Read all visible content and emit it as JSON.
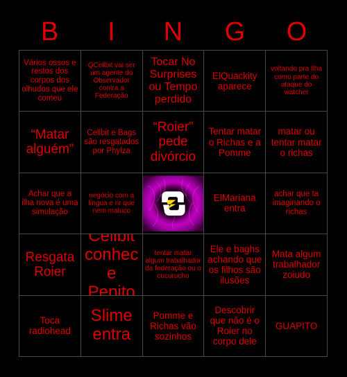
{
  "header": {
    "letters": [
      "B",
      "I",
      "N",
      "G",
      "O"
    ]
  },
  "colors": {
    "text_red": "#e00000",
    "background": "#000000",
    "grid_line": "#4a4a4a",
    "free_space_accent_purple": "#c000c0",
    "free_space_accent_yellow": "#ffe000"
  },
  "grid": {
    "columns": 5,
    "rows": 5,
    "cells": [
      {
        "text": "Vários ossos e restos dos corpos dos olhudos que ele comeu",
        "size": "sm"
      },
      {
        "text": "QCellbit vai ser um agente do Observador contra a Federação",
        "size": "xs"
      },
      {
        "text": "Tocar No Surprises ou Tempo perdido",
        "size": "lg"
      },
      {
        "text": "ElQuackity aparece",
        "size": "md"
      },
      {
        "text": "voltando pra Ilha como parte do ataque do watcher",
        "size": "xs"
      },
      {
        "text": "“Matar alguém”",
        "size": "xl"
      },
      {
        "text": "Cellbit e Bags são resgatados por Phylza",
        "size": "sm"
      },
      {
        "text": "“Roier” pede divórcio",
        "size": "xl"
      },
      {
        "text": "Tentar matar o Richas e a Pomme",
        "size": "md"
      },
      {
        "text": "matar ou tentar matar o richas",
        "size": "md"
      },
      {
        "text": "Achar que a ilha nova é uma simulação",
        "size": "sm"
      },
      {
        "text": "negócio com a língua e rir que nem maluco",
        "size": "xs"
      },
      {
        "text": "",
        "size": "free",
        "is_free_space": true,
        "icon": "qsmp-logo-icon"
      },
      {
        "text": "ElMariana entra",
        "size": "md"
      },
      {
        "text": "achar que ta imaginando o richas",
        "size": "sm"
      },
      {
        "text": "Resgata Roier",
        "size": "xl"
      },
      {
        "text": "Cellbit conhece Pepito",
        "size": "xxl"
      },
      {
        "text": "tentar matar algum trabalhador da federação ou o cucurucho",
        "size": "xs"
      },
      {
        "text": "Ele e baghs achando que os filhos são ilusões",
        "size": "md"
      },
      {
        "text": "Mata algum trabalhador zoiudo",
        "size": "md"
      },
      {
        "text": "Toca radiohead",
        "size": "md"
      },
      {
        "text": "Slime entra",
        "size": "xxl"
      },
      {
        "text": "Pomme e Richas vão sozinhos",
        "size": "md"
      },
      {
        "text": "Descobrir que não é o Roier no corpo dele",
        "size": "md"
      },
      {
        "text": "GUAPITO",
        "size": "md"
      }
    ]
  }
}
